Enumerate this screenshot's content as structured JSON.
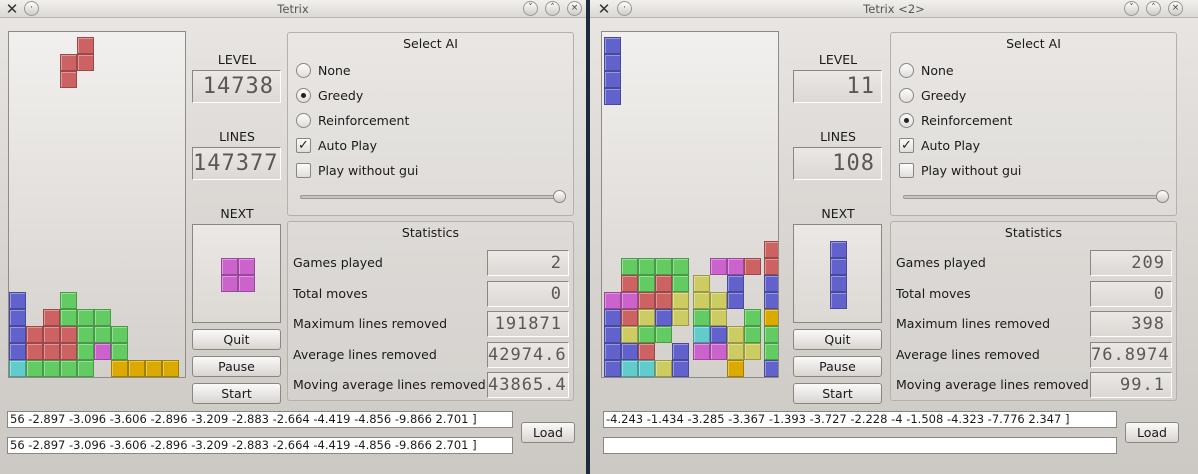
{
  "windows": [
    {
      "title": "Tetrix",
      "level_label": "LEVEL",
      "level_value": "14738",
      "lines_label": "LINES",
      "lines_value": "147377",
      "next_label": "NEXT",
      "buttons": {
        "quit": "Quit",
        "pause": "Pause",
        "start": "Start"
      },
      "select_ai": {
        "title": "Select AI",
        "options": [
          "None",
          "Greedy",
          "Reinforcement"
        ],
        "selected": "Greedy",
        "auto_play_label": "Auto Play",
        "auto_play_checked": true,
        "play_without_gui_label": "Play without gui",
        "play_without_gui_checked": false,
        "slider_value_fraction": 1.0
      },
      "statistics": {
        "title": "Statistics",
        "rows": [
          {
            "label": "Games played",
            "value": "2"
          },
          {
            "label": "Total moves",
            "value": "0"
          },
          {
            "label": "Maximum lines removed",
            "value": "191871"
          },
          {
            "label": "Average lines removed",
            "value": "42974.6"
          },
          {
            "label": "Moving average lines removed",
            "value": "43865.4"
          }
        ]
      },
      "weights_line_1": "56 -2.897 -3.096 -3.606 -2.896 -3.209 -2.883 -2.664 -4.419 -4.856 -9.866 2.701 ]",
      "weights_line_2": "56 -2.897 -3.096 -3.606 -2.896 -3.209 -2.883 -2.664 -4.419 -4.856 -9.866 2.701 ]",
      "load_label": "Load",
      "colors": {
        "red": "#cc6262",
        "blue": "#6262cc",
        "green": "#62cc62",
        "yellow": "#cccc62",
        "magenta": "#cc62cc",
        "cyan": "#62cccc",
        "orange": "#daaa00"
      }
    },
    {
      "title": "Tetrix <2>",
      "level_label": "LEVEL",
      "level_value": "11",
      "lines_label": "LINES",
      "lines_value": "108",
      "next_label": "NEXT",
      "buttons": {
        "quit": "Quit",
        "pause": "Pause",
        "start": "Start"
      },
      "select_ai": {
        "title": "Select AI",
        "options": [
          "None",
          "Greedy",
          "Reinforcement"
        ],
        "selected": "Reinforcement",
        "auto_play_label": "Auto Play",
        "auto_play_checked": true,
        "play_without_gui_label": "Play without gui",
        "play_without_gui_checked": false,
        "slider_value_fraction": 1.0
      },
      "statistics": {
        "title": "Statistics",
        "rows": [
          {
            "label": "Games played",
            "value": "209"
          },
          {
            "label": "Total moves",
            "value": "0"
          },
          {
            "label": "Maximum lines removed",
            "value": "398"
          },
          {
            "label": "Average lines removed",
            "value": "76.8974"
          },
          {
            "label": "Moving average lines removed",
            "value": "99.1"
          }
        ]
      },
      "weights_line_1": "-4.243 -1.434 -3.285 -3.367 -1.393 -3.727 -2.228 -4 -1.508 -4.323 -7.776 2.347 ]",
      "weights_line_2": "",
      "load_label": "Load"
    }
  ]
}
